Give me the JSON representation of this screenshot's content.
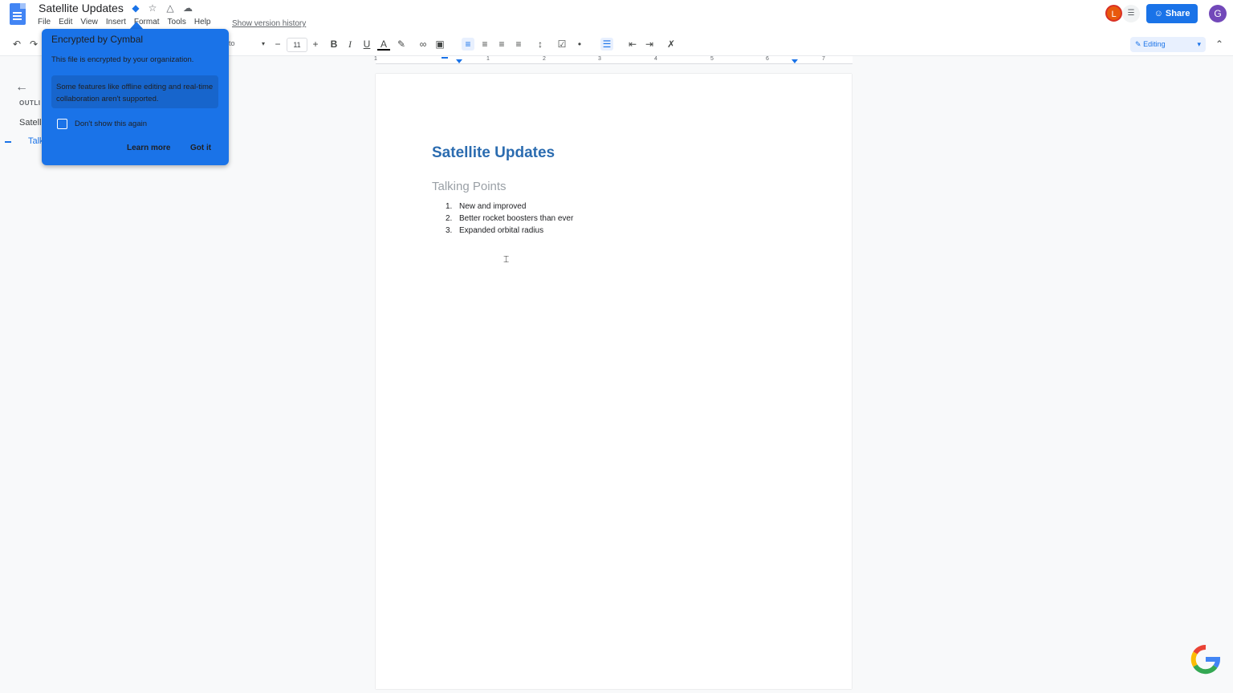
{
  "app": {
    "title": "Satellite Updates",
    "menu": [
      "File",
      "Edit",
      "View",
      "Insert",
      "Format",
      "Tools",
      "Help"
    ],
    "version_history": "Show version history",
    "share_label": "Share",
    "avatar_l": "L",
    "avatar_g": "G"
  },
  "toolbar": {
    "font_name": "oto",
    "font_size": "11",
    "mode": "Editing",
    "ruler_numbers": [
      "1",
      "1",
      "2",
      "3",
      "4",
      "5",
      "6",
      "7"
    ]
  },
  "outline": {
    "label": "OUTLI",
    "items": [
      "Satell",
      "Talk"
    ]
  },
  "document": {
    "title": "Satellite Updates",
    "subtitle": "Talking Points",
    "list": [
      {
        "num": "1.",
        "text": "New and improved"
      },
      {
        "num": "2.",
        "text": "Better rocket boosters than ever"
      },
      {
        "num": "3.",
        "text": "Expanded orbital radius"
      }
    ]
  },
  "popup": {
    "title": "Encrypted by Cymbal",
    "body": "This file is encrypted by your organization.",
    "note": "Some features like offline editing and real-time collaboration aren't supported.",
    "checkbox_label": "Don't show this again",
    "learn_more": "Learn more",
    "got_it": "Got it"
  },
  "colors": {
    "accent": "#1a73e8",
    "title_blue": "#2b6cb0"
  }
}
